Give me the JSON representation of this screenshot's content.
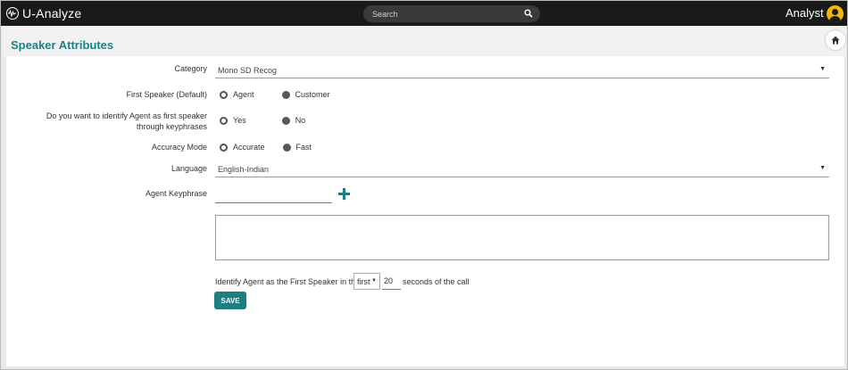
{
  "app": {
    "logo_text": "U-Analyze",
    "search_placeholder": "Search",
    "user_name": "Analyst",
    "accent_color": "#1e7f86",
    "avatar_color": "#f2b705"
  },
  "page": {
    "title": "Speaker Attributes"
  },
  "form": {
    "category": {
      "label": "Category",
      "value": "Mono SD Recog"
    },
    "first_speaker": {
      "label": "First Speaker (Default)",
      "options": [
        "Agent",
        "Customer"
      ],
      "selected": "Agent"
    },
    "identify_keyphrases": {
      "label_line1": "Do you want to identify Agent as first speaker",
      "label_line2": "through keyphrases",
      "options": [
        "Yes",
        "No"
      ],
      "selected": "Yes"
    },
    "accuracy_mode": {
      "label": "Accuracy Mode",
      "options": [
        "Accurate",
        "Fast"
      ],
      "selected": "Accurate"
    },
    "language": {
      "label": "Language",
      "value": "English-Indian"
    },
    "agent_keyphrase": {
      "label": "Agent Keyphrase",
      "value": ""
    },
    "identify_sentence": {
      "prefix": "Identify Agent as the First Speaker in the",
      "position_value": "first",
      "seconds_value": "20",
      "suffix": "seconds of the call"
    },
    "save_label": "SAVE"
  }
}
